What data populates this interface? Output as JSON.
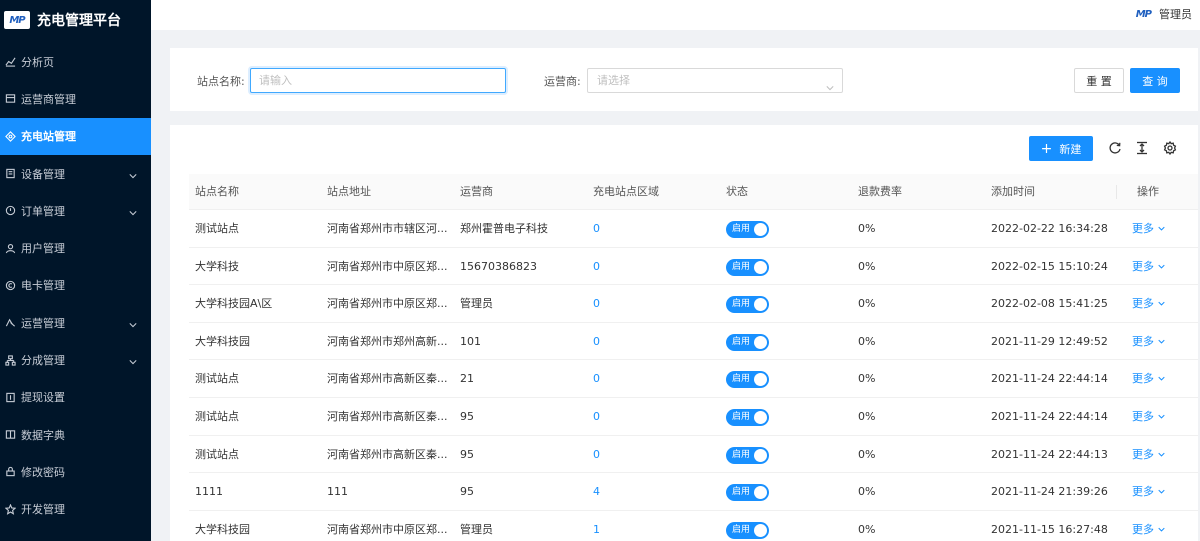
{
  "app": {
    "title": "充电管理平台",
    "logo_text": "MP"
  },
  "header": {
    "user_name": "管理员",
    "user_logo": "MP"
  },
  "sidebar": {
    "items": [
      {
        "label": "分析页",
        "icon": "chart-line-icon",
        "has_children": false,
        "active": false
      },
      {
        "label": "运营商管理",
        "icon": "store-icon",
        "has_children": false,
        "active": false
      },
      {
        "label": "充电站管理",
        "icon": "location-icon",
        "has_children": false,
        "active": true
      },
      {
        "label": "设备管理",
        "icon": "device-icon",
        "has_children": true,
        "active": false
      },
      {
        "label": "订单管理",
        "icon": "order-icon",
        "has_children": true,
        "active": false
      },
      {
        "label": "用户管理",
        "icon": "user-icon",
        "has_children": false,
        "active": false
      },
      {
        "label": "电卡管理",
        "icon": "card-icon",
        "has_children": false,
        "active": false
      },
      {
        "label": "运营管理",
        "icon": "operation-icon",
        "has_children": true,
        "active": false
      },
      {
        "label": "分成管理",
        "icon": "share-icon",
        "has_children": true,
        "active": false
      },
      {
        "label": "提现设置",
        "icon": "withdraw-icon",
        "has_children": false,
        "active": false
      },
      {
        "label": "数据字典",
        "icon": "book-icon",
        "has_children": false,
        "active": false
      },
      {
        "label": "修改密码",
        "icon": "lock-icon",
        "has_children": false,
        "active": false
      },
      {
        "label": "开发管理",
        "icon": "star-icon",
        "has_children": false,
        "active": false
      }
    ]
  },
  "search": {
    "station_name_label": "站点名称:",
    "station_name_placeholder": "请输入",
    "station_name_value": "",
    "operator_label": "运营商:",
    "operator_placeholder": "请选择",
    "reset_label": "重 置",
    "query_label": "查 询"
  },
  "toolbar": {
    "new_label": "新建"
  },
  "table": {
    "columns": [
      "站点名称",
      "站点地址",
      "运营商",
      "充电站点区域",
      "状态",
      "退款费率",
      "添加时间",
      "操作"
    ],
    "status_on_label": "启用",
    "more_label": "更多",
    "rows": [
      {
        "name": "测试站点",
        "address": "河南省郑州市市辖区河...",
        "operator": "郑州霍普电子科技",
        "area": "0",
        "status": "启用",
        "refund_rate": "0%",
        "created": "2022-02-22 16:34:28"
      },
      {
        "name": "大学科技",
        "address": "河南省郑州市中原区郑...",
        "operator": "15670386823",
        "area": "0",
        "status": "启用",
        "refund_rate": "0%",
        "created": "2022-02-15 15:10:24"
      },
      {
        "name": "大学科技园A\\区",
        "address": "河南省郑州市中原区郑...",
        "operator": "管理员",
        "area": "0",
        "status": "启用",
        "refund_rate": "0%",
        "created": "2022-02-08 15:41:25"
      },
      {
        "name": "大学科技园",
        "address": "河南省郑州市郑州高新...",
        "operator": "101",
        "area": "0",
        "status": "启用",
        "refund_rate": "0%",
        "created": "2021-11-29 12:49:52"
      },
      {
        "name": "测试站点",
        "address": "河南省郑州市高新区秦...",
        "operator": "21",
        "area": "0",
        "status": "启用",
        "refund_rate": "0%",
        "created": "2021-11-24 22:44:14"
      },
      {
        "name": "测试站点",
        "address": "河南省郑州市高新区秦...",
        "operator": "95",
        "area": "0",
        "status": "启用",
        "refund_rate": "0%",
        "created": "2021-11-24 22:44:14"
      },
      {
        "name": "测试站点",
        "address": "河南省郑州市高新区秦...",
        "operator": "95",
        "area": "0",
        "status": "启用",
        "refund_rate": "0%",
        "created": "2021-11-24 22:44:13"
      },
      {
        "name": "1111",
        "address": "111",
        "operator": "95",
        "area": "4",
        "status": "启用",
        "refund_rate": "0%",
        "created": "2021-11-24 21:39:26"
      },
      {
        "name": "大学科技园",
        "address": "河南省郑州市中原区郑...",
        "operator": "管理员",
        "area": "1",
        "status": "启用",
        "refund_rate": "0%",
        "created": "2021-11-15 16:27:48"
      }
    ]
  },
  "colors": {
    "primary": "#1890ff",
    "sidebar_bg": "#001529",
    "page_bg": "#f0f2f5"
  }
}
